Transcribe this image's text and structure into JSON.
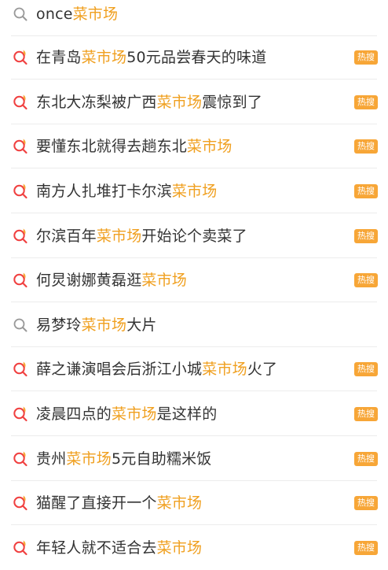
{
  "colors": {
    "highlight": "#f0a020",
    "badge": "#f7a637",
    "text": "#333333",
    "search_icon_gray": "#999999"
  },
  "suggestions": [
    {
      "prefix": "once",
      "keyword": "菜市场",
      "suffix": "",
      "icon": "search-icon",
      "badge": ""
    },
    {
      "prefix": "在青岛",
      "keyword": "菜市场",
      "suffix": "50元品尝春天的味道",
      "icon": "hot-search-icon",
      "badge": "热搜"
    },
    {
      "prefix": "东北大冻梨被广西",
      "keyword": "菜市场",
      "suffix": "震惊到了",
      "icon": "hot-search-icon",
      "badge": "热搜"
    },
    {
      "prefix": "要懂东北就得去趟东北",
      "keyword": "菜市场",
      "suffix": "",
      "icon": "hot-search-icon",
      "badge": "热搜"
    },
    {
      "prefix": "南方人扎堆打卡尔滨",
      "keyword": "菜市场",
      "suffix": "",
      "icon": "hot-search-icon",
      "badge": "热搜"
    },
    {
      "prefix": "尔滨百年",
      "keyword": "菜市场",
      "suffix": "开始论个卖菜了",
      "icon": "hot-search-icon",
      "badge": "热搜"
    },
    {
      "prefix": "何炅谢娜黄磊逛",
      "keyword": "菜市场",
      "suffix": "",
      "icon": "hot-search-icon",
      "badge": "热搜"
    },
    {
      "prefix": "易梦玲",
      "keyword": "菜市场",
      "suffix": "大片",
      "icon": "search-icon",
      "badge": ""
    },
    {
      "prefix": "薛之谦演唱会后浙江小城",
      "keyword": "菜市场",
      "suffix": "火了",
      "icon": "hot-search-icon",
      "badge": "热搜"
    },
    {
      "prefix": "凌晨四点的",
      "keyword": "菜市场",
      "suffix": "是这样的",
      "icon": "hot-search-icon",
      "badge": "热搜"
    },
    {
      "prefix": "贵州",
      "keyword": "菜市场",
      "suffix": "5元自助糯米饭",
      "icon": "hot-search-icon",
      "badge": "热搜"
    },
    {
      "prefix": "猫醒了直接开一个",
      "keyword": "菜市场",
      "suffix": "",
      "icon": "hot-search-icon",
      "badge": "热搜"
    },
    {
      "prefix": "年轻人就不适合去",
      "keyword": "菜市场",
      "suffix": "",
      "icon": "hot-search-icon",
      "badge": "热搜"
    }
  ]
}
